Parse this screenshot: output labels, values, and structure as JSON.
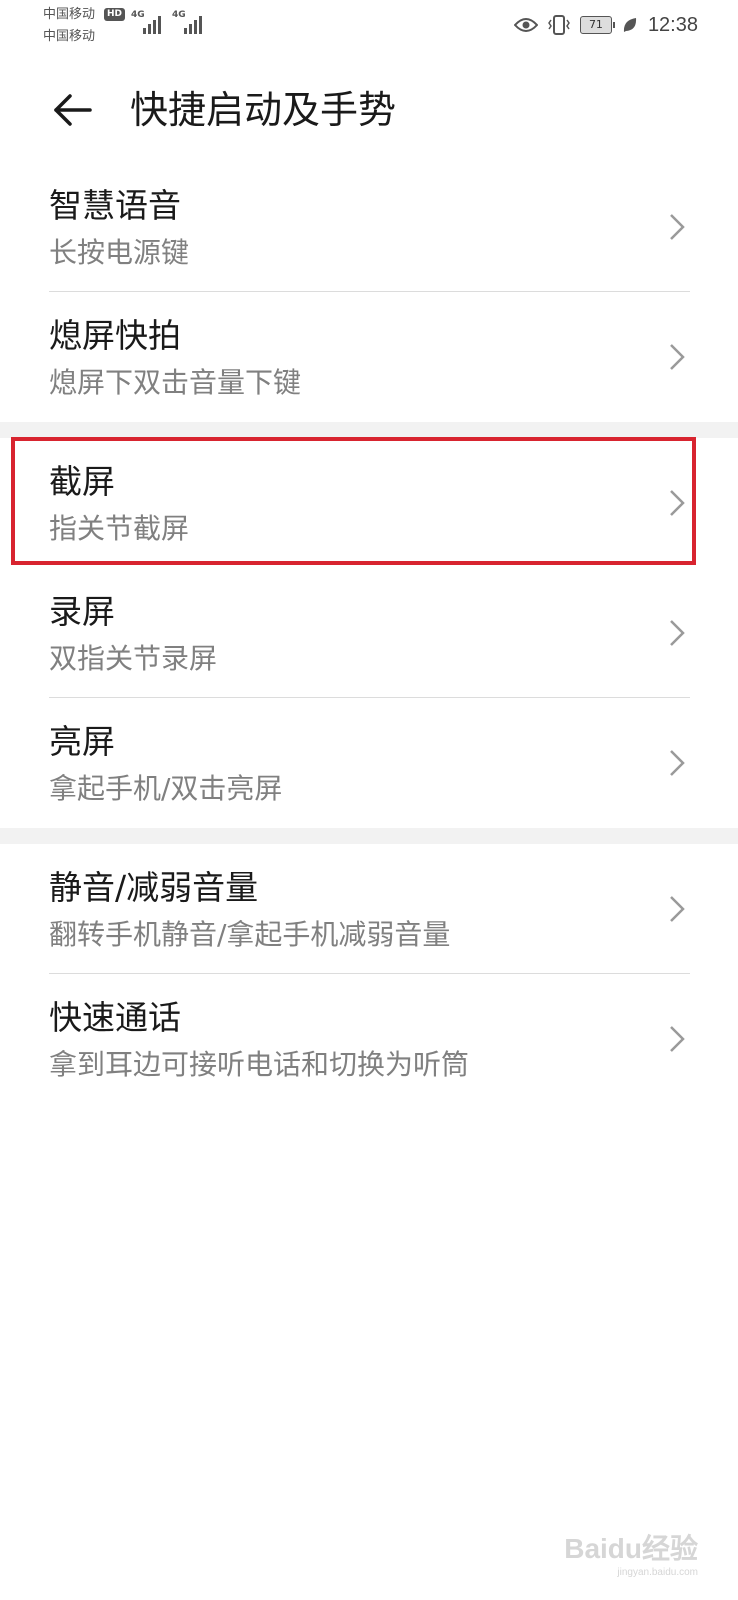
{
  "status_bar": {
    "carrier1": "中国移动",
    "carrier2": "中国移动",
    "hd": "HD",
    "network1": "4G",
    "network2": "4G",
    "battery": "71",
    "time": "12:38"
  },
  "header": {
    "title": "快捷启动及手势"
  },
  "groups": [
    {
      "items": [
        {
          "title": "智慧语音",
          "subtitle": "长按电源键"
        },
        {
          "title": "熄屏快拍",
          "subtitle": "熄屏下双击音量下键"
        }
      ]
    },
    {
      "items": [
        {
          "title": "截屏",
          "subtitle": "指关节截屏"
        },
        {
          "title": "录屏",
          "subtitle": "双指关节录屏"
        },
        {
          "title": "亮屏",
          "subtitle": "拿起手机/双击亮屏"
        }
      ]
    },
    {
      "items": [
        {
          "title": "静音/减弱音量",
          "subtitle": "翻转手机静音/拿起手机减弱音量"
        },
        {
          "title": "快速通话",
          "subtitle": "拿到耳边可接听电话和切换为听筒"
        }
      ]
    }
  ],
  "watermark": {
    "text": "Baidu经验",
    "url": "jingyan.baidu.com"
  },
  "colors": {
    "highlight": "#d8242f",
    "section_gap": "#f2f2f2"
  }
}
